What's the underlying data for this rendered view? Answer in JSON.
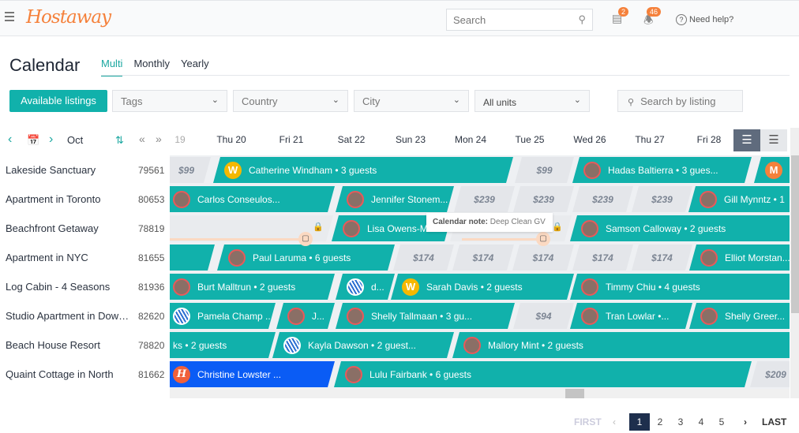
{
  "topbar": {
    "logo": "Hostaway",
    "search_placeholder": "Search",
    "tasks_badge": "2",
    "notifications_badge": "46",
    "help": "Need help?"
  },
  "page": {
    "title": "Calendar",
    "tabs": [
      {
        "label": "Multi",
        "active": true
      },
      {
        "label": "Monthly"
      },
      {
        "label": "Yearly"
      }
    ]
  },
  "filters": {
    "available": "Available listings",
    "tags": "Tags",
    "country": "Country",
    "city": "City",
    "units": "All units",
    "search_placeholder": "Search by listing"
  },
  "nav": {
    "month": "Oct",
    "days": [
      "19",
      "Thu 20",
      "Fri 21",
      "Sat 22",
      "Sun 23",
      "Mon 24",
      "Tue 25",
      "Wed 26",
      "Thu 27",
      "Fri 28"
    ]
  },
  "listings": [
    {
      "name": "Lakeside Sanctuary",
      "id": "79561"
    },
    {
      "name": "Apartment in Toronto",
      "id": "80653"
    },
    {
      "name": "Beachfront Getaway",
      "id": "78819"
    },
    {
      "name": "Apartment in NYC",
      "id": "81655"
    },
    {
      "name": "Log Cabin - 4 Seasons",
      "id": "81936"
    },
    {
      "name": "Studio Apartment in Downtown",
      "id": "82620"
    },
    {
      "name": "Beach House Resort",
      "id": "78820"
    },
    {
      "name": "Quaint Cottage in North",
      "id": "81662"
    }
  ],
  "rows": [
    [
      {
        "t": "price",
        "v": "$99"
      },
      {
        "t": "book",
        "v": "Catherine Windham • 3 guests",
        "a": "W"
      },
      {
        "t": "price",
        "v": "$99"
      },
      {
        "t": "book",
        "v": "Hadas Baltierra • 3 gues...",
        "a": "photo"
      },
      {
        "t": "book",
        "v": "M",
        "a": "M"
      }
    ],
    [
      {
        "t": "book",
        "v": "Carlos Conseulos...",
        "a": "photo"
      },
      {
        "t": "book",
        "v": "Jennifer Stonem...",
        "a": "photo"
      },
      {
        "t": "price",
        "v": "$239"
      },
      {
        "t": "price",
        "v": "$239"
      },
      {
        "t": "price",
        "v": "$239"
      },
      {
        "t": "price",
        "v": "$239"
      },
      {
        "t": "book",
        "v": "Gill Mynntz • 1",
        "a": "photo"
      }
    ],
    [
      {
        "t": "blocked"
      },
      {
        "t": "book",
        "v": "Lisa Owens-M...",
        "a": "photo"
      },
      {
        "t": "blocked"
      },
      {
        "t": "book",
        "v": "Samson Calloway • 2 guests",
        "a": "photo"
      }
    ],
    [
      {
        "t": "book",
        "v": "",
        "a": ""
      },
      {
        "t": "book",
        "v": "Paul Laruma • 6 guests",
        "a": "photo"
      },
      {
        "t": "price",
        "v": "$174"
      },
      {
        "t": "price",
        "v": "$174"
      },
      {
        "t": "price",
        "v": "$174"
      },
      {
        "t": "price",
        "v": "$174"
      },
      {
        "t": "price",
        "v": "$174"
      },
      {
        "t": "book",
        "v": "Elliot Morstan...",
        "a": "photo"
      }
    ],
    [
      {
        "t": "book",
        "v": "Burt Malltrun • 2 guests",
        "a": "photo"
      },
      {
        "t": "book",
        "v": "d...",
        "a": "S"
      },
      {
        "t": "book",
        "v": "Sarah Davis • 2 guests",
        "a": "W"
      },
      {
        "t": "book",
        "v": "Timmy Chiu • 4 guests",
        "a": "photo"
      }
    ],
    [
      {
        "t": "book",
        "v": "Pamela Champ ...",
        "a": "S"
      },
      {
        "t": "book",
        "v": "J...",
        "a": "photo"
      },
      {
        "t": "book",
        "v": "Shelly Tallmaan • 3 gu...",
        "a": "photo"
      },
      {
        "t": "price",
        "v": "$94"
      },
      {
        "t": "book",
        "v": "Tran Lowlar •...",
        "a": "photo"
      },
      {
        "t": "book",
        "v": "Shelly Greer...",
        "a": "photo"
      }
    ],
    [
      {
        "t": "book",
        "v": "ks • 2 guests",
        "a": ""
      },
      {
        "t": "book",
        "v": "Kayla Dawson • 2 guest...",
        "a": "S"
      },
      {
        "t": "book",
        "v": "Mallory Mint • 2 guests",
        "a": "photo"
      }
    ],
    [
      {
        "t": "book",
        "v": "Christine Lowster ...",
        "a": "H",
        "blue": true
      },
      {
        "t": "book",
        "v": "Lulu Fairbank • 6 guests",
        "a": "photo"
      },
      {
        "t": "price",
        "v": "$209"
      }
    ]
  ],
  "note": {
    "label": "Calendar note:",
    "text": "Deep Clean GV"
  },
  "pagination": {
    "first": "FIRST",
    "pages": [
      "1",
      "2",
      "3",
      "4",
      "5"
    ],
    "current": "1",
    "last": "LAST"
  },
  "colors": {
    "accent": "#11b1ab",
    "booking": "#11b1ab",
    "direct_booking": "#0a5cf5",
    "brand": "#f5813b"
  }
}
